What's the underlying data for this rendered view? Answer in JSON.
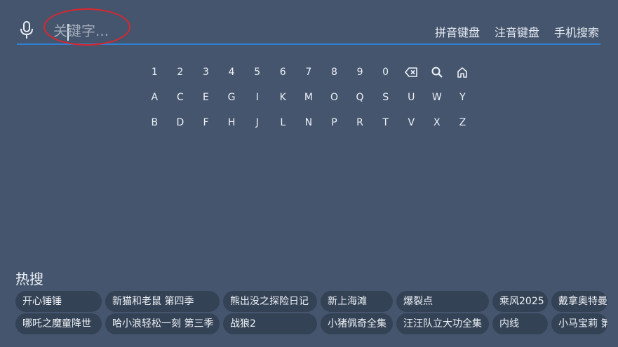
{
  "search": {
    "placeholder": "关键字..."
  },
  "input_modes": [
    "拼音键盘",
    "注音键盘",
    "手机搜索"
  ],
  "keyboard": {
    "row1": [
      "1",
      "2",
      "3",
      "4",
      "5",
      "6",
      "7",
      "8",
      "9",
      "0"
    ],
    "row1_icons": [
      "backspace-icon",
      "search-icon",
      "home-icon"
    ],
    "row2": [
      "A",
      "C",
      "E",
      "G",
      "I",
      "K",
      "M",
      "O",
      "Q",
      "S",
      "U",
      "W",
      "Y"
    ],
    "row3": [
      "B",
      "D",
      "F",
      "H",
      "J",
      "L",
      "N",
      "P",
      "R",
      "T",
      "V",
      "X",
      "Z"
    ]
  },
  "hot_search": {
    "title": "热搜",
    "row1": [
      "开心锤锤",
      "新猫和老鼠 第四季",
      "熊出没之探险日记",
      "新上海滩",
      "爆裂点",
      "乘风2025",
      "戴拿奥特曼"
    ],
    "row2": [
      "哪吒之魔童降世",
      "哈小浪轻松一刻 第三季",
      "战狼2",
      "小猪佩奇全集",
      "汪汪队立大功全集",
      "内线",
      "小马宝莉 第"
    ]
  },
  "colors": {
    "background": "#45556e",
    "chip": "#344255",
    "accent_line": "#2f80d1",
    "annotation": "#d9272e"
  }
}
